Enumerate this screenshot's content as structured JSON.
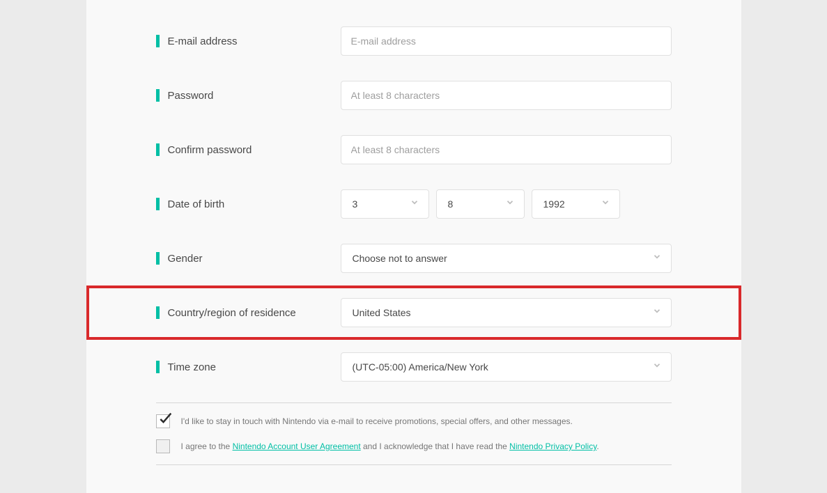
{
  "form": {
    "email": {
      "label": "E-mail address",
      "placeholder": "E-mail address",
      "value": ""
    },
    "password": {
      "label": "Password",
      "placeholder": "At least 8 characters",
      "value": ""
    },
    "confirm_password": {
      "label": "Confirm password",
      "placeholder": "At least 8 characters",
      "value": ""
    },
    "dob": {
      "label": "Date of birth",
      "month": "3",
      "day": "8",
      "year": "1992"
    },
    "gender": {
      "label": "Gender",
      "value": "Choose not to answer"
    },
    "country": {
      "label": "Country/region of residence",
      "value": "United States"
    },
    "timezone": {
      "label": "Time zone",
      "value": "(UTC-05:00) America/New York"
    }
  },
  "checkboxes": {
    "newsletter": {
      "checked": true,
      "text": "I'd like to stay in touch with Nintendo via e-mail to receive promotions, special offers, and other messages."
    },
    "agreement": {
      "checked": false,
      "prefix": "I agree to the ",
      "link1": "Nintendo Account User Agreement",
      "mid": " and I acknowledge that I have read the ",
      "link2": "Nintendo Privacy Policy",
      "suffix": "."
    }
  },
  "colors": {
    "accent": "#00bfa5",
    "highlight_border": "#d9292b"
  }
}
